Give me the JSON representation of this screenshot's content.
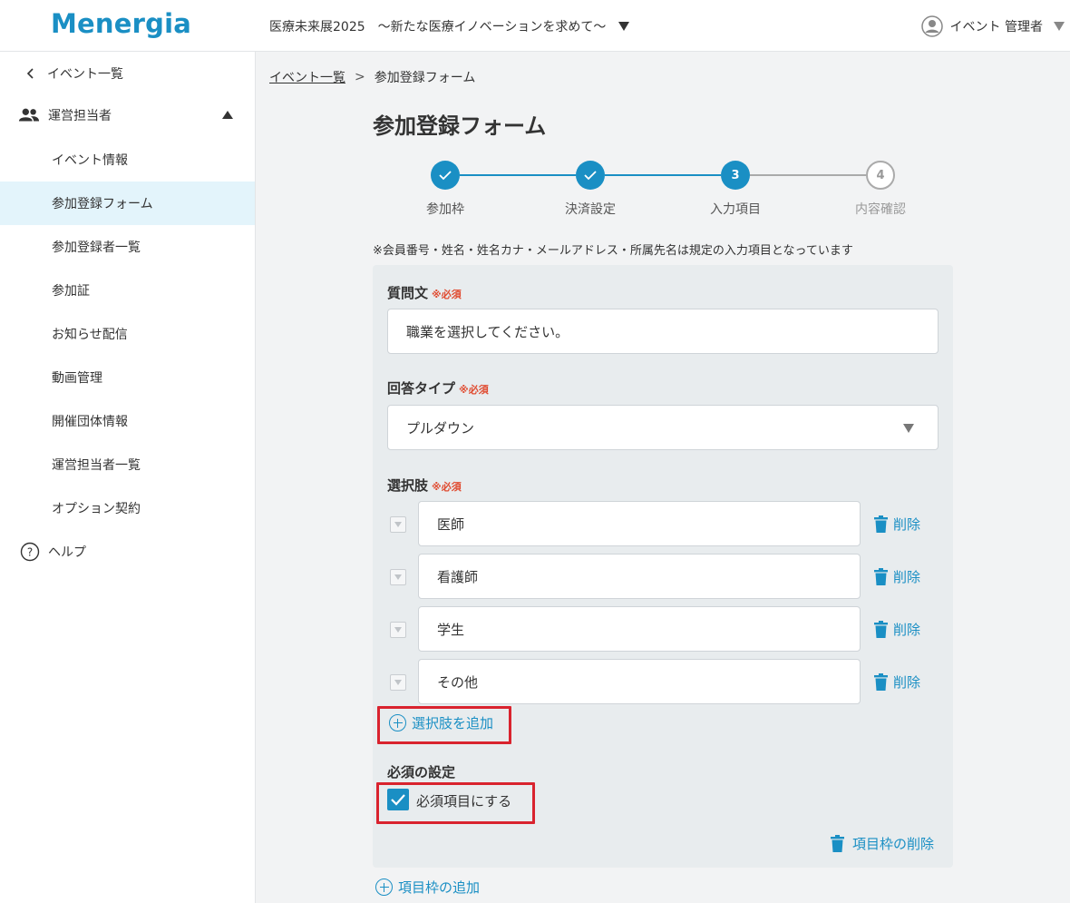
{
  "header": {
    "logo": "Menergia",
    "event_name": "医療未来展2025　〜新たな医療イノベーションを求めて〜",
    "user_name": "イベント 管理者"
  },
  "sidebar": {
    "back_label": "イベント一覧",
    "section_label": "運営担当者",
    "items": [
      {
        "label": "イベント情報"
      },
      {
        "label": "参加登録フォーム"
      },
      {
        "label": "参加登録者一覧"
      },
      {
        "label": "参加証"
      },
      {
        "label": "お知らせ配信"
      },
      {
        "label": "動画管理"
      },
      {
        "label": "開催団体情報"
      },
      {
        "label": "運営担当者一覧"
      },
      {
        "label": "オプション契約"
      }
    ],
    "help_label": "ヘルプ"
  },
  "breadcrumb": {
    "parent": "イベント一覧",
    "separator": ">",
    "current": "参加登録フォーム"
  },
  "page_title": "参加登録フォーム",
  "stepper": {
    "steps": [
      {
        "number": "1",
        "label": "参加枠",
        "state": "done"
      },
      {
        "number": "2",
        "label": "決済設定",
        "state": "done"
      },
      {
        "number": "3",
        "label": "入力項目",
        "state": "current"
      },
      {
        "number": "4",
        "label": "内容確認",
        "state": "todo"
      }
    ]
  },
  "note": "※会員番号・姓名・姓名カナ・メールアドレス・所属先名は規定の入力項目となっています",
  "form": {
    "question_label": "質問文",
    "required_mark": "※必須",
    "question_value": "職業を選択してください。",
    "answer_type_label": "回答タイプ",
    "answer_type_value": "プルダウン",
    "options_label": "選択肢",
    "options": [
      {
        "value": "医師"
      },
      {
        "value": "看護師"
      },
      {
        "value": "学生"
      },
      {
        "value": "その他"
      }
    ],
    "delete_label": "削除",
    "add_option_label": "選択肢を追加",
    "required_setting_label": "必須の設定",
    "required_checkbox_label": "必須項目にする",
    "required_checked": true,
    "delete_block_label": "項目枠の削除"
  },
  "add_block_label": "項目枠の追加",
  "colors": {
    "accent": "#1a8fc4",
    "required": "#e04a2f",
    "highlight": "#d9232e",
    "active_bg": "#e3f4fb"
  }
}
